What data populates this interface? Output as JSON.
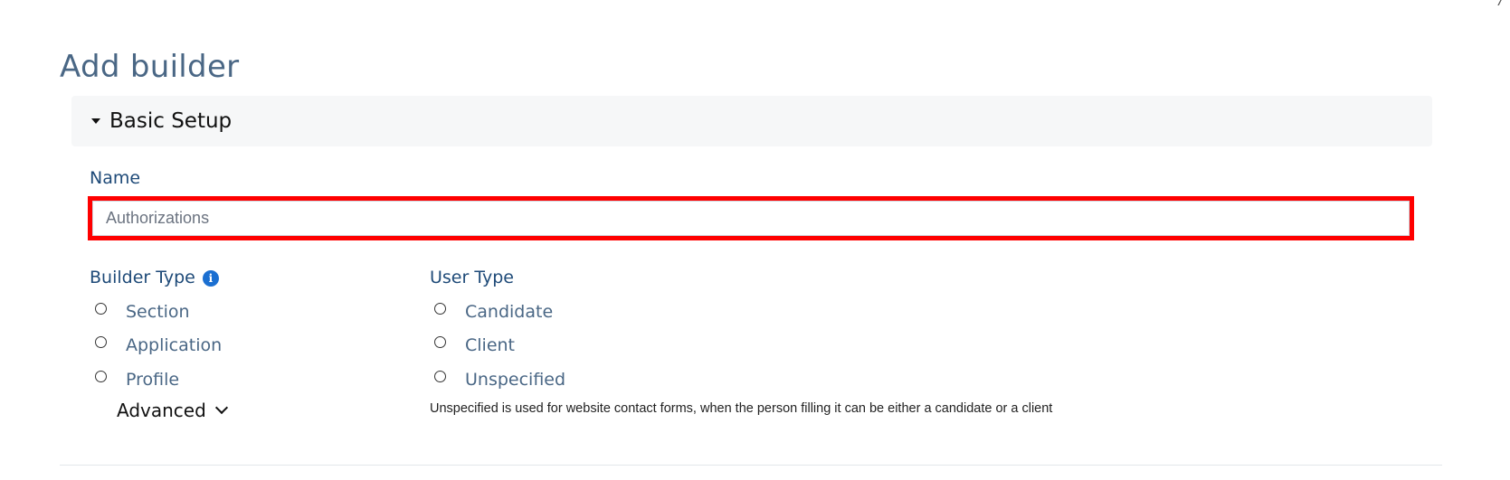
{
  "page": {
    "title": "Add builder"
  },
  "section": {
    "title": "Basic Setup"
  },
  "name_field": {
    "label": "Name",
    "value": "Authorizations"
  },
  "builder_type": {
    "label": "Builder Type",
    "options": [
      "Section",
      "Application",
      "Profile"
    ],
    "advanced_label": "Advanced"
  },
  "user_type": {
    "label": "User Type",
    "options": [
      "Candidate",
      "Client",
      "Unspecified"
    ],
    "help_text": "Unspecified is used for website contact forms, when the person filling it can be either a candidate or a client"
  },
  "icons": {
    "info": "info-icon",
    "caret": "caret-down-icon",
    "chevron": "chevron-down-icon",
    "close": "close-icon"
  },
  "colors": {
    "title": "#4a6785",
    "label": "#1e4a78",
    "highlight_border": "#ff0000",
    "info_icon": "#1b6fd1",
    "section_bg": "#f6f7f8"
  }
}
